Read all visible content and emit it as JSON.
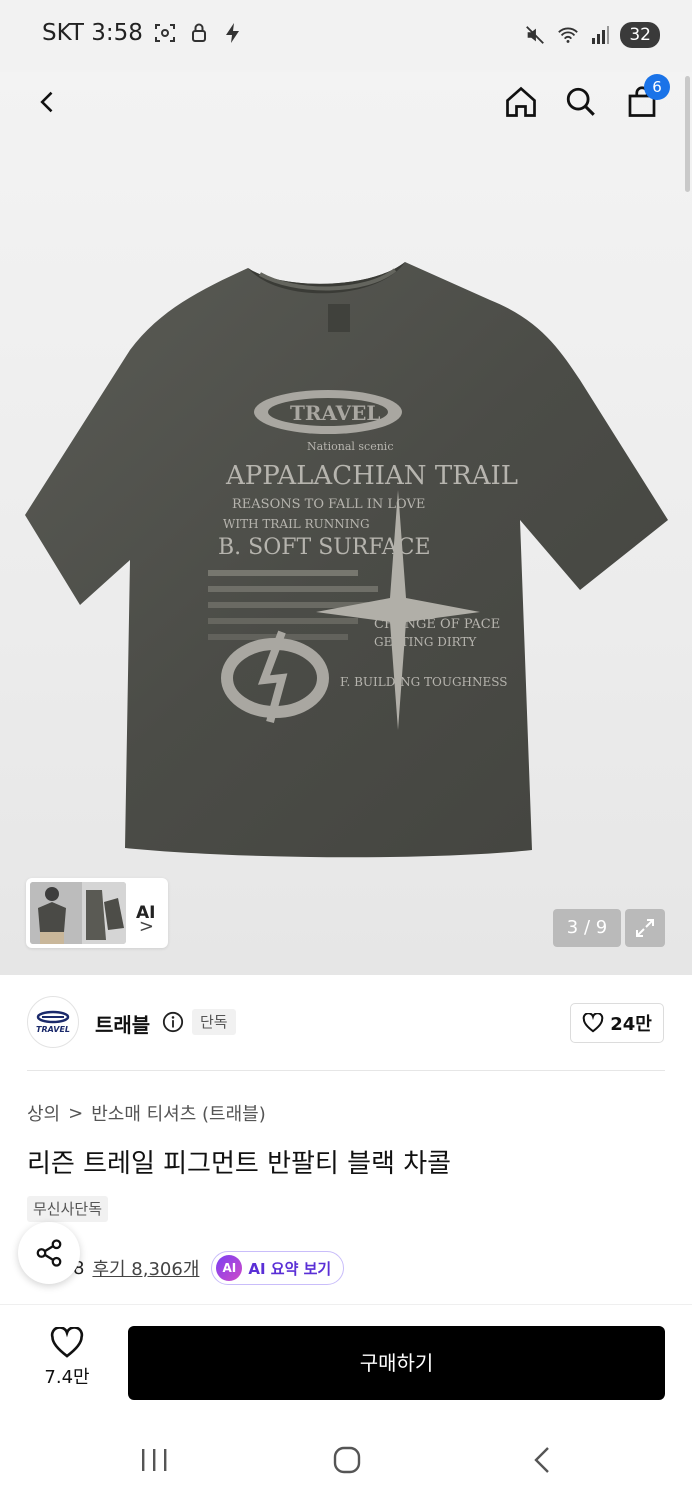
{
  "status_bar": {
    "carrier_time": "SKT 3:58",
    "battery": "32"
  },
  "header": {
    "cart_count": "6"
  },
  "gallery": {
    "ai_thumb_label": "AI",
    "ai_thumb_chevron": ">",
    "pager": "3 / 9",
    "print": {
      "line1": "National scenic",
      "line2": "APPALACHIAN TRAIL",
      "line3": "REASONS TO FALL IN LOVE",
      "line4": "WITH TRAIL RUNNING",
      "line5": "B. SOFT SURFACE",
      "line6": "CHANGE OF PACE",
      "line7": "GETTING DIRTY",
      "line8": "F. BUILDING TOUGHNESS"
    }
  },
  "brand": {
    "logo_text": "TRAVEL",
    "name": "트래블",
    "exclusive": "단독",
    "likes": "24만"
  },
  "breadcrumb": {
    "level1": "상의",
    "separator": ">",
    "level2": "반소매 티셔츠 (트래블)"
  },
  "product": {
    "title": "리즌 트레일 피그먼트 반팔티 블랙 차콜",
    "store_tag": "무신사단독"
  },
  "reviews": {
    "rating": "8",
    "review_link": "후기 8,306개",
    "ai_badge": "AI",
    "ai_summary": "AI 요약 보기"
  },
  "bottom_bar": {
    "wish_count": "7.4만",
    "buy_label": "구매하기"
  },
  "colors": {
    "accent_badge": "#1a73e8",
    "buy_button": "#000000",
    "ai_purple": "#5a2fd6"
  }
}
